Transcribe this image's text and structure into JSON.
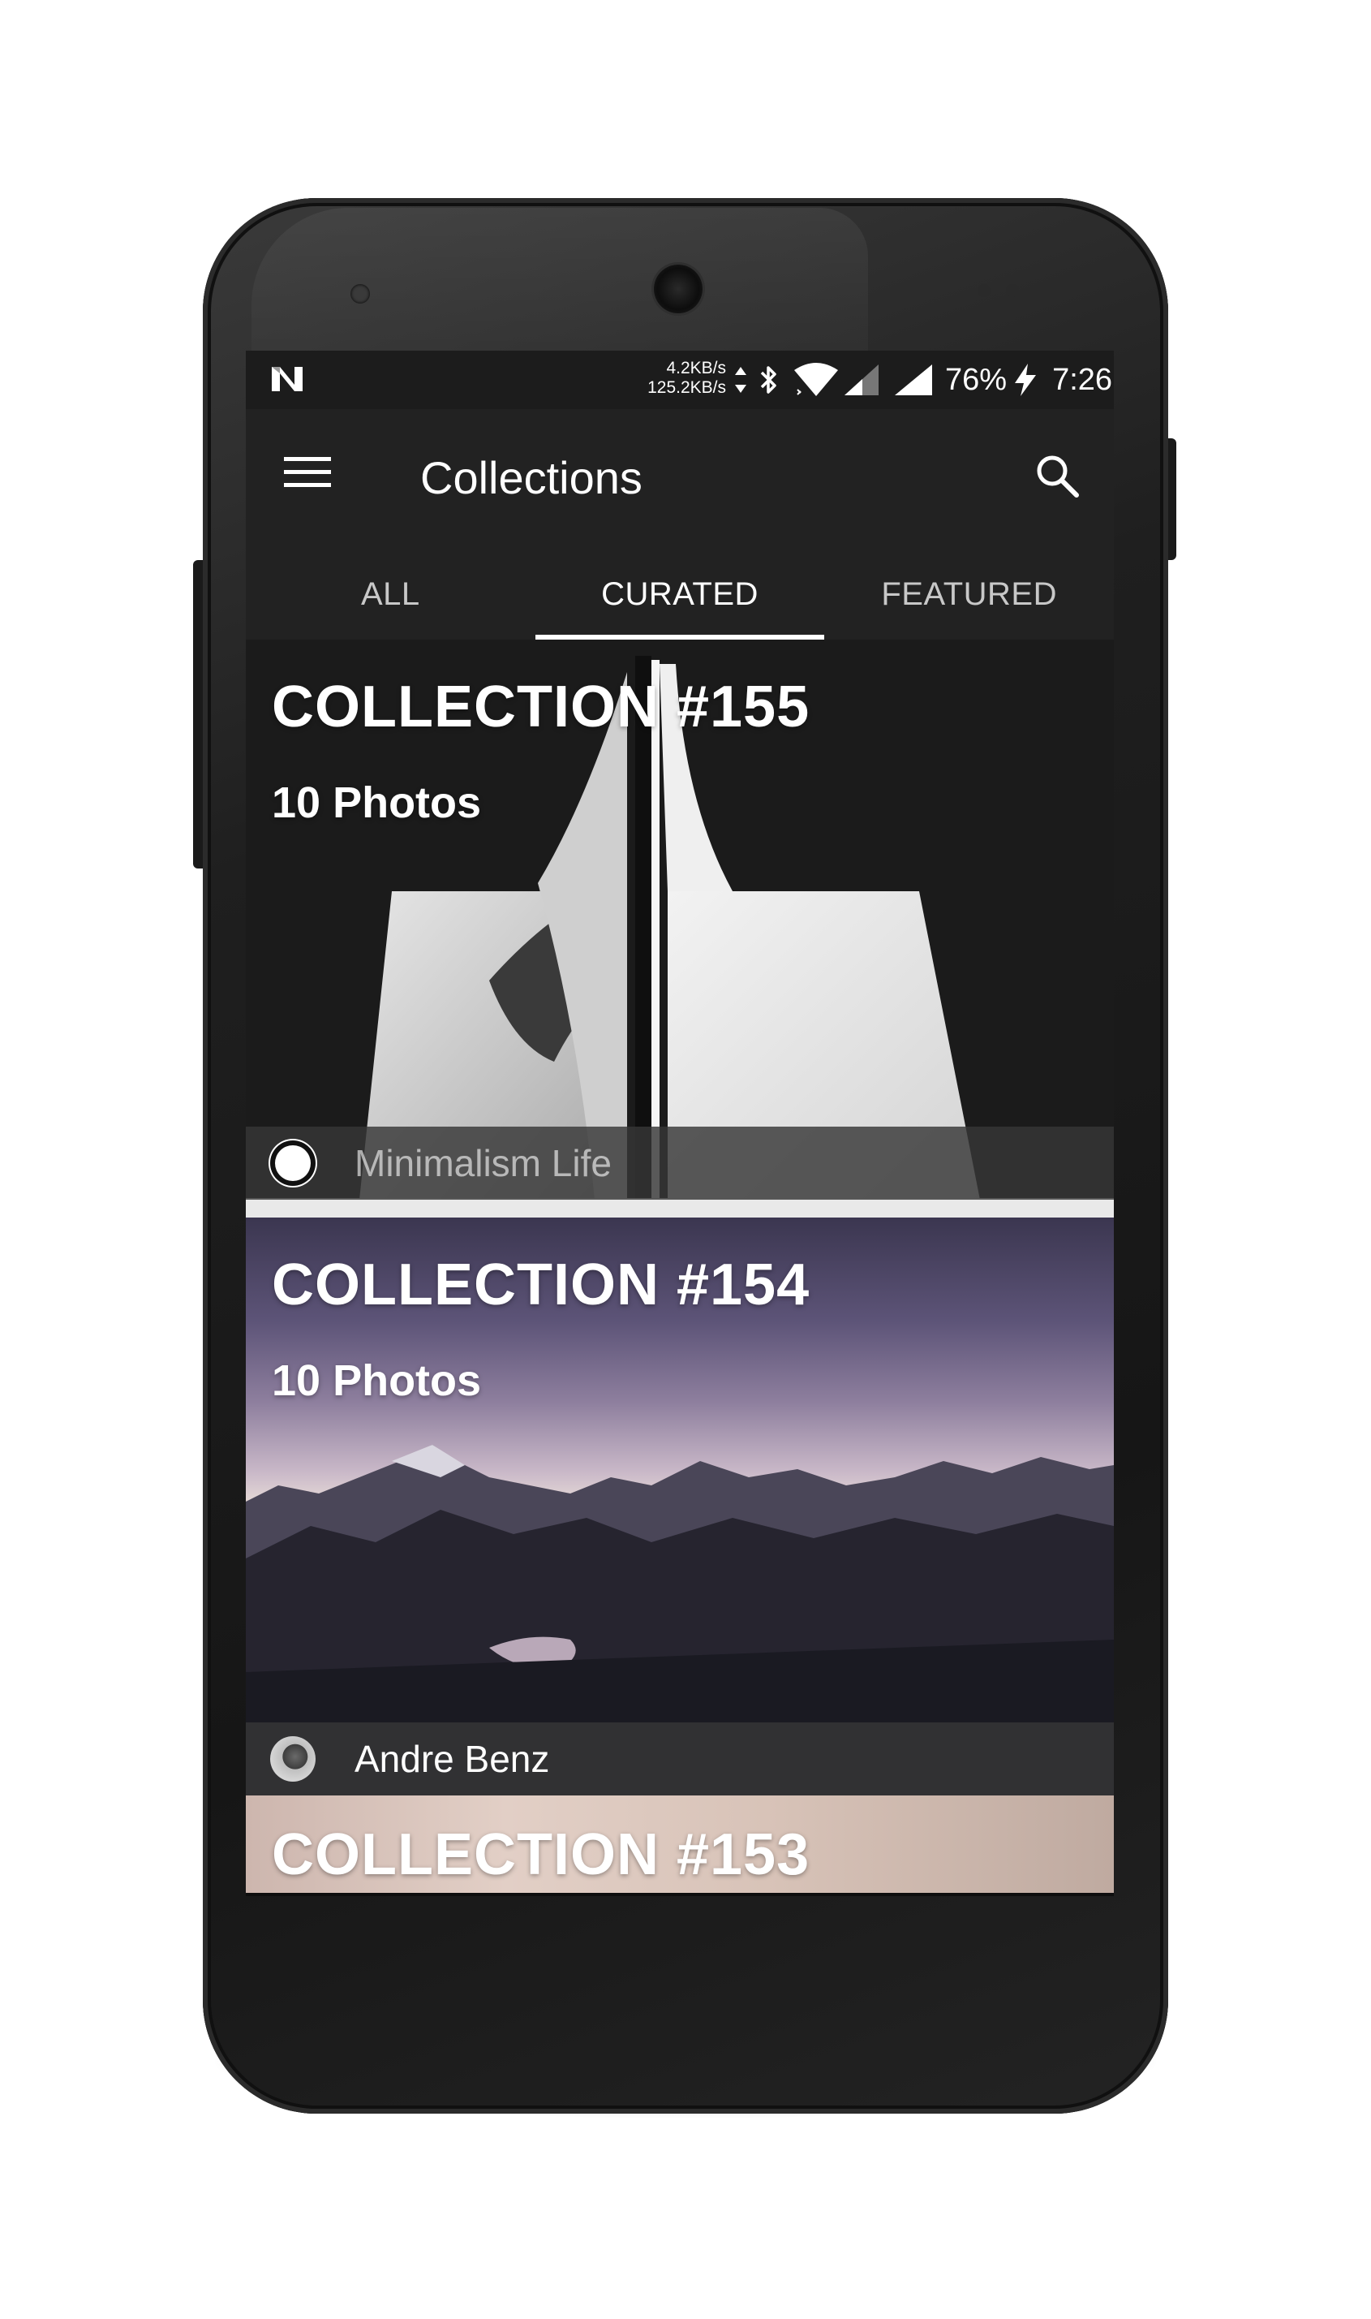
{
  "status_bar": {
    "net_speed_up": "4.2KB/s",
    "net_speed_down": "125.2KB/s",
    "battery": "76%",
    "time": "7:26",
    "icons": [
      "n-logo-icon",
      "bluetooth-icon",
      "wifi-icon",
      "signal-icon",
      "signal-full-icon",
      "charging-icon"
    ]
  },
  "app_bar": {
    "title": "Collections",
    "menu_icon": "hamburger-menu-icon",
    "search_icon": "search-icon"
  },
  "tabs": [
    {
      "label": "ALL",
      "active": false
    },
    {
      "label": "CURATED",
      "active": true
    },
    {
      "label": "FEATURED",
      "active": false
    }
  ],
  "collections": [
    {
      "title": "COLLECTION #155",
      "subtitle": "10 Photos",
      "author": "Minimalism Life"
    },
    {
      "title": "COLLECTION #154",
      "subtitle": "10 Photos",
      "author": "Andre Benz"
    },
    {
      "title": "COLLECTION #153"
    }
  ],
  "colors": {
    "app_bar": "#222222",
    "status_bar": "#1c1c1c",
    "tab_indicator": "#ffffff",
    "text_primary": "#ffffff"
  }
}
